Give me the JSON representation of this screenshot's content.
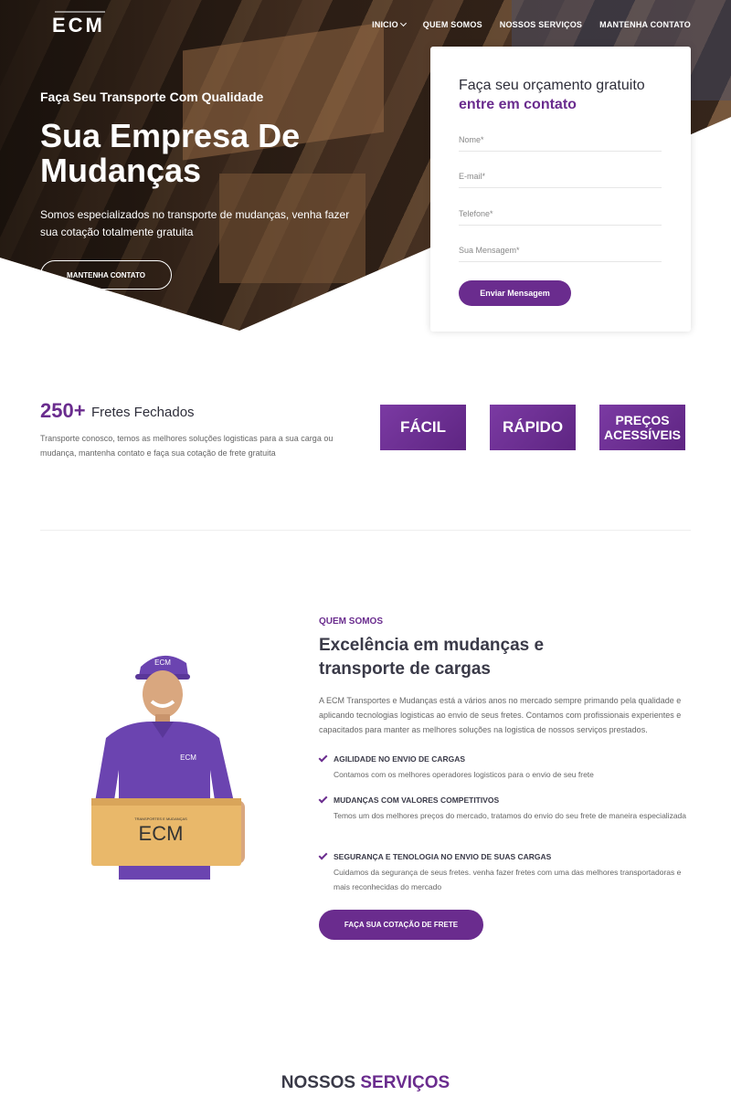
{
  "header": {
    "logo": "ECM",
    "nav": [
      {
        "label": "INICIO"
      },
      {
        "label": "QUEM SOMOS"
      },
      {
        "label": "NOSSOS SERVIÇOS"
      },
      {
        "label": "MANTENHA CONTATO"
      }
    ]
  },
  "hero": {
    "kicker": "Faça Seu Transporte Com Qualidade",
    "title": "Sua Empresa De Mudanças",
    "description": "Somos especializados no transporte de mudanças, venha fazer sua cotação totalmente gratuita",
    "button": "MANTENHA CONTATO"
  },
  "form": {
    "title_part1": "Faça seu orçamento gratuito",
    "title_highlight": "entre em contato",
    "fields": {
      "name": "Nome*",
      "email": "E-mail*",
      "phone": "Telefone*",
      "message": "Sua Mensagem*"
    },
    "submit": "Enviar Mensagem"
  },
  "stats": {
    "number": "250+",
    "label": "Fretes Fechados",
    "description": "Transporte conosco, temos as melhores soluções logisticas para a sua carga ou mudança, mantenha contato e faça sua cotação de frete gratuita",
    "badges": [
      "FÁCIL",
      "RÁPIDO",
      "PREÇOS ACESSÍVEIS"
    ]
  },
  "about": {
    "kicker": "QUEM SOMOS",
    "title": "Excelência em mudanças e transporte de cargas",
    "description": "A ECM Transportes e Mudanças está a vários anos no mercado sempre primando pela qualidade e aplicando tecnologias logisticas ao envio de seus fretes. Contamos com profissionais experientes e capacitados para manter as melhores soluções na logistica de nossos serviços prestados.",
    "features": [
      {
        "title": "AGILIDADE NO ENVIO DE CARGAS",
        "text": "Contamos com os melhores operadores logisticos para o envio de seu frete"
      },
      {
        "title": "MUDANÇAS COM VALORES COMPETITIVOS",
        "text": "Temos um dos melhores preços do mercado, tratamos do envio do seu frete de maneira especializada"
      },
      {
        "title": "SEGURANÇA E TENOLOGIA NO ENVIO DE SUAS CARGAS",
        "text": "Cuidamos da segurança de seus fretes. venha fazer fretes com uma das melhores transportadoras e mais reconhecidas do mercado"
      }
    ],
    "button": "FAÇA SUA COTAÇÃO DE FRETE",
    "worker_cap_text": "ECM",
    "worker_shirt_text": "ECM",
    "box_text": "ECM",
    "box_small_text": "TRANSPORTES E MUDANÇAS"
  },
  "services": {
    "title_part1": "NOSSOS",
    "title_highlight": "SERVIÇOS"
  },
  "colors": {
    "accent": "#6a2c8e",
    "dark_text": "#3a3a48"
  }
}
